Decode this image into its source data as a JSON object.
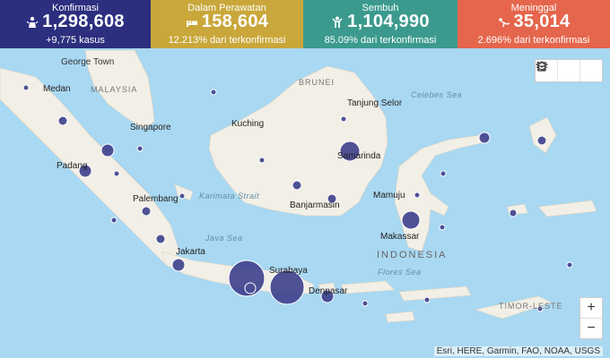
{
  "header": {
    "konfirmasi": {
      "label": "Konfirmasi",
      "value": "1,298,608",
      "sub": "+9,775 kasus"
    },
    "perawatan": {
      "label": "Dalam Perawatan",
      "value": "158,604",
      "sub": "12.213% dari terkonfirmasi"
    },
    "sembuh": {
      "label": "Sembuh",
      "value": "1,104,990",
      "sub": "85.09% dari terkonfirmasi"
    },
    "meninggal": {
      "label": "Meninggal",
      "value": "35,014",
      "sub": "2.696% dari terkonfirmasi"
    }
  },
  "colors": {
    "konfirmasi": "#2b2f7e",
    "perawatan": "#c9a73a",
    "sembuh": "#3b9a8d",
    "meninggal": "#e5664c",
    "bubble": "#3d3f8c",
    "land": "#f2efe6"
  },
  "map": {
    "labels": {
      "george_town": "George Town",
      "malaysia": "MALAYSIA",
      "brunei": "BRUNEI",
      "medan": "Medan",
      "celebes_sea": "Celebes Sea",
      "tanjung_selor": "Tanjung Selor",
      "kuching": "Kuching",
      "singapore": "Singapore",
      "samarinda": "Samarinda",
      "padang": "Padang",
      "palembang": "Palembang",
      "karimata_strait": "Karimata Strait",
      "mamuju": "Mamuju",
      "banjarmasin": "Banjarmasin",
      "java_sea": "Java Sea",
      "makassar": "Makassar",
      "jakarta": "Jakarta",
      "indonesia": "INDONESIA",
      "surabaya": "Surabaya",
      "flores_sea": "Flores Sea",
      "denpasar": "Denpasar",
      "timor_leste": "TIMOR-LESTE"
    },
    "tool_icons": [
      "home-icon",
      "legend-icon",
      "layers-icon"
    ],
    "zoom_in": "+",
    "zoom_out": "−",
    "attribution": "Esri, HERE, Garmin, FAO, NOAA, USGS"
  }
}
